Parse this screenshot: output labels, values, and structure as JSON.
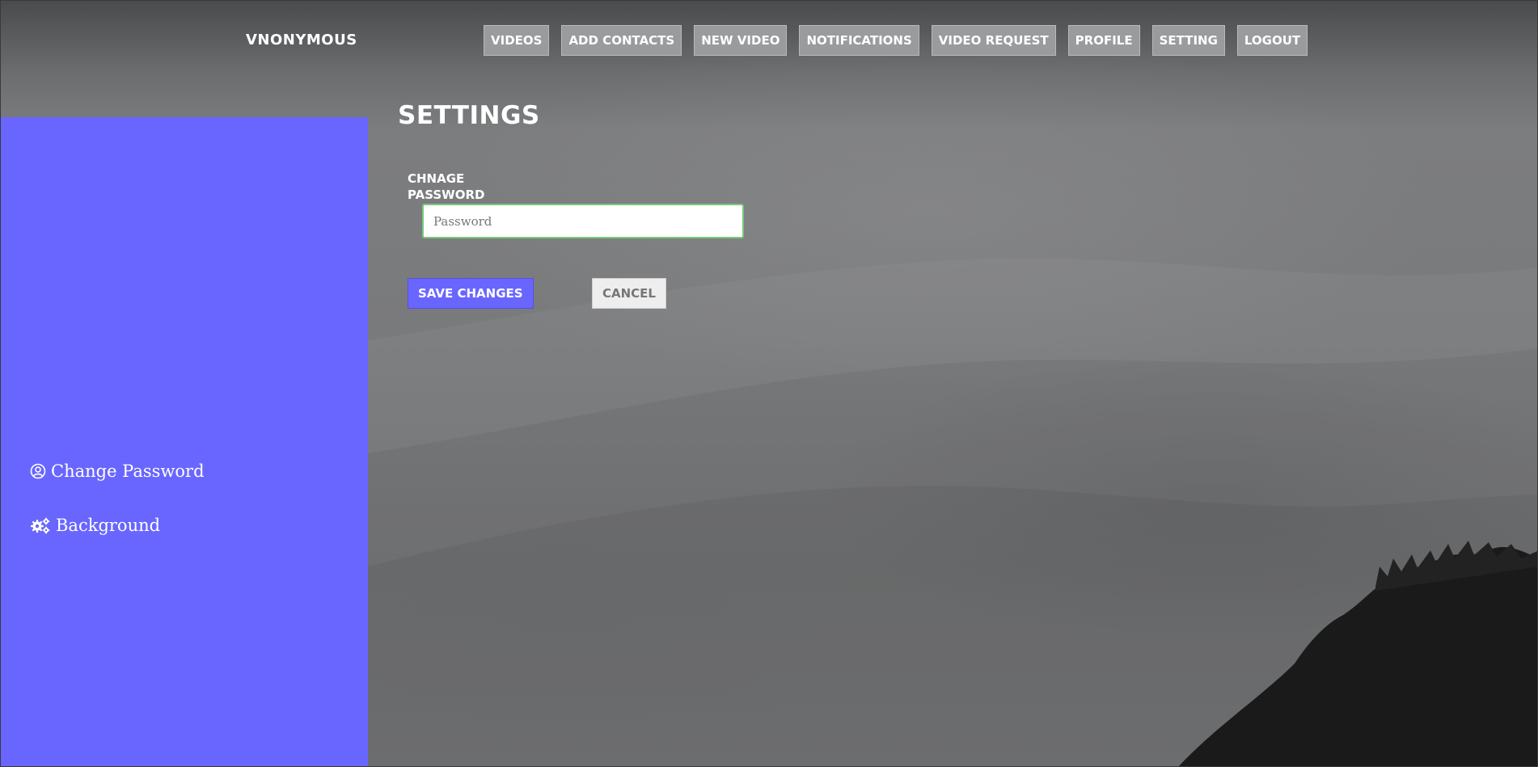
{
  "header": {
    "brand": "VNONYMOUS",
    "nav": [
      {
        "label": "VIDEOS"
      },
      {
        "label": "ADD CONTACTS"
      },
      {
        "label": "NEW VIDEO"
      },
      {
        "label": "NOTIFICATIONS"
      },
      {
        "label": "VIDEO REQUEST"
      },
      {
        "label": "PROFILE"
      },
      {
        "label": "SETTING"
      },
      {
        "label": "LOGOUT"
      }
    ]
  },
  "sidebar": {
    "items": [
      {
        "label": "Change Password",
        "icon": "user-circle-icon"
      },
      {
        "label": "Background",
        "icon": "gears-icon"
      }
    ]
  },
  "main": {
    "title": "SETTINGS",
    "field_label": "CHNAGE PASSWORD",
    "password_placeholder": "Password",
    "password_value": "",
    "save_label": "SAVE CHANGES",
    "cancel_label": "CANCEL"
  },
  "colors": {
    "accent": "#6966ff",
    "nav_button_bg": "#9a9b9d",
    "input_focus_border": "#7ac97a"
  }
}
